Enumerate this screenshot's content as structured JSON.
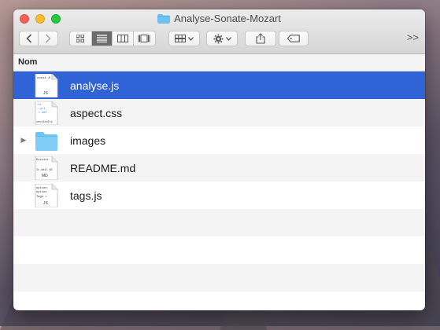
{
  "window": {
    "title": "Analyse-Sonate-Mozart",
    "title_icon": "folder-icon"
  },
  "toolbar": {
    "back_icon": "chevron-left-icon",
    "forward_icon": "chevron-right-icon",
    "view_modes": [
      "icon-view-icon",
      "list-view-icon",
      "column-view-icon",
      "gallery-view-icon"
    ],
    "active_view": "list",
    "arrange_icon": "arrange-grid-icon",
    "action_icon": "gear-icon",
    "share_icon": "share-icon",
    "tags_icon": "tag-icon",
    "overflow_label": ">>"
  },
  "list": {
    "column_header": "Nom",
    "items": [
      {
        "name": "analyse.js",
        "kind": "js",
        "selected": true,
        "thumb_lines": [
          "const A",
          "",
          "JS"
        ]
      },
      {
        "name": "aspect.css",
        "kind": "css",
        "selected": false,
        "thumb_lines": [
          ":ro",
          "--pri",
          "= #ef",
          "sectionTit"
        ]
      },
      {
        "name": "images",
        "kind": "folder",
        "selected": false,
        "expandable": true
      },
      {
        "name": "README.md",
        "kind": "md",
        "selected": false,
        "thumb_lines": [
          "Dossier",
          "",
          "It.dail Kt",
          "MD"
        ]
      },
      {
        "name": "tags.js",
        "kind": "js",
        "selected": false,
        "thumb_lines": [
          "option",
          "option",
          "Tags =",
          "JS"
        ]
      }
    ],
    "empty_rows": 4
  },
  "colors": {
    "selection": "#2f63d6",
    "folder": "#6ec3f3",
    "close": "#fc5f57",
    "minimize": "#fdbc2e",
    "maximize": "#28c840"
  }
}
